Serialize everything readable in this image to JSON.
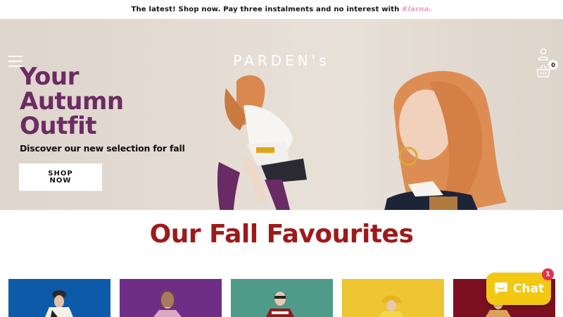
{
  "announcement": {
    "text": "The latest! Shop now. Pay three instalments and no interest with",
    "klarna": "Klarna."
  },
  "header": {
    "logo": "PARDEN's",
    "cart_count": "0",
    "icons": [
      "menu-icon",
      "user-icon",
      "basket-icon"
    ]
  },
  "hero": {
    "title_line1": "Your",
    "title_line2": "Autumn",
    "title_line3": "Outfit",
    "subtitle": "Discover our new selection for fall",
    "cta_line1": "SHOP",
    "cta_line2": "NOW",
    "slide_count": 2,
    "active_slide": 1
  },
  "section": {
    "title": "Our Fall Favourites"
  },
  "products": [
    {
      "background": "#0d5ba8"
    },
    {
      "background": "#6e2e86"
    },
    {
      "background": "#4f9a88"
    },
    {
      "background": "#efc531"
    },
    {
      "background": "#7c1020"
    }
  ],
  "chat": {
    "label": "Chat",
    "badge": "1"
  },
  "colors": {
    "brand_purple": "#6c2c63",
    "section_red": "#9e1a1a",
    "chat_yellow": "#f2c811",
    "klarna_pink": "#f3a0b6",
    "badge_red": "#e2334e"
  }
}
